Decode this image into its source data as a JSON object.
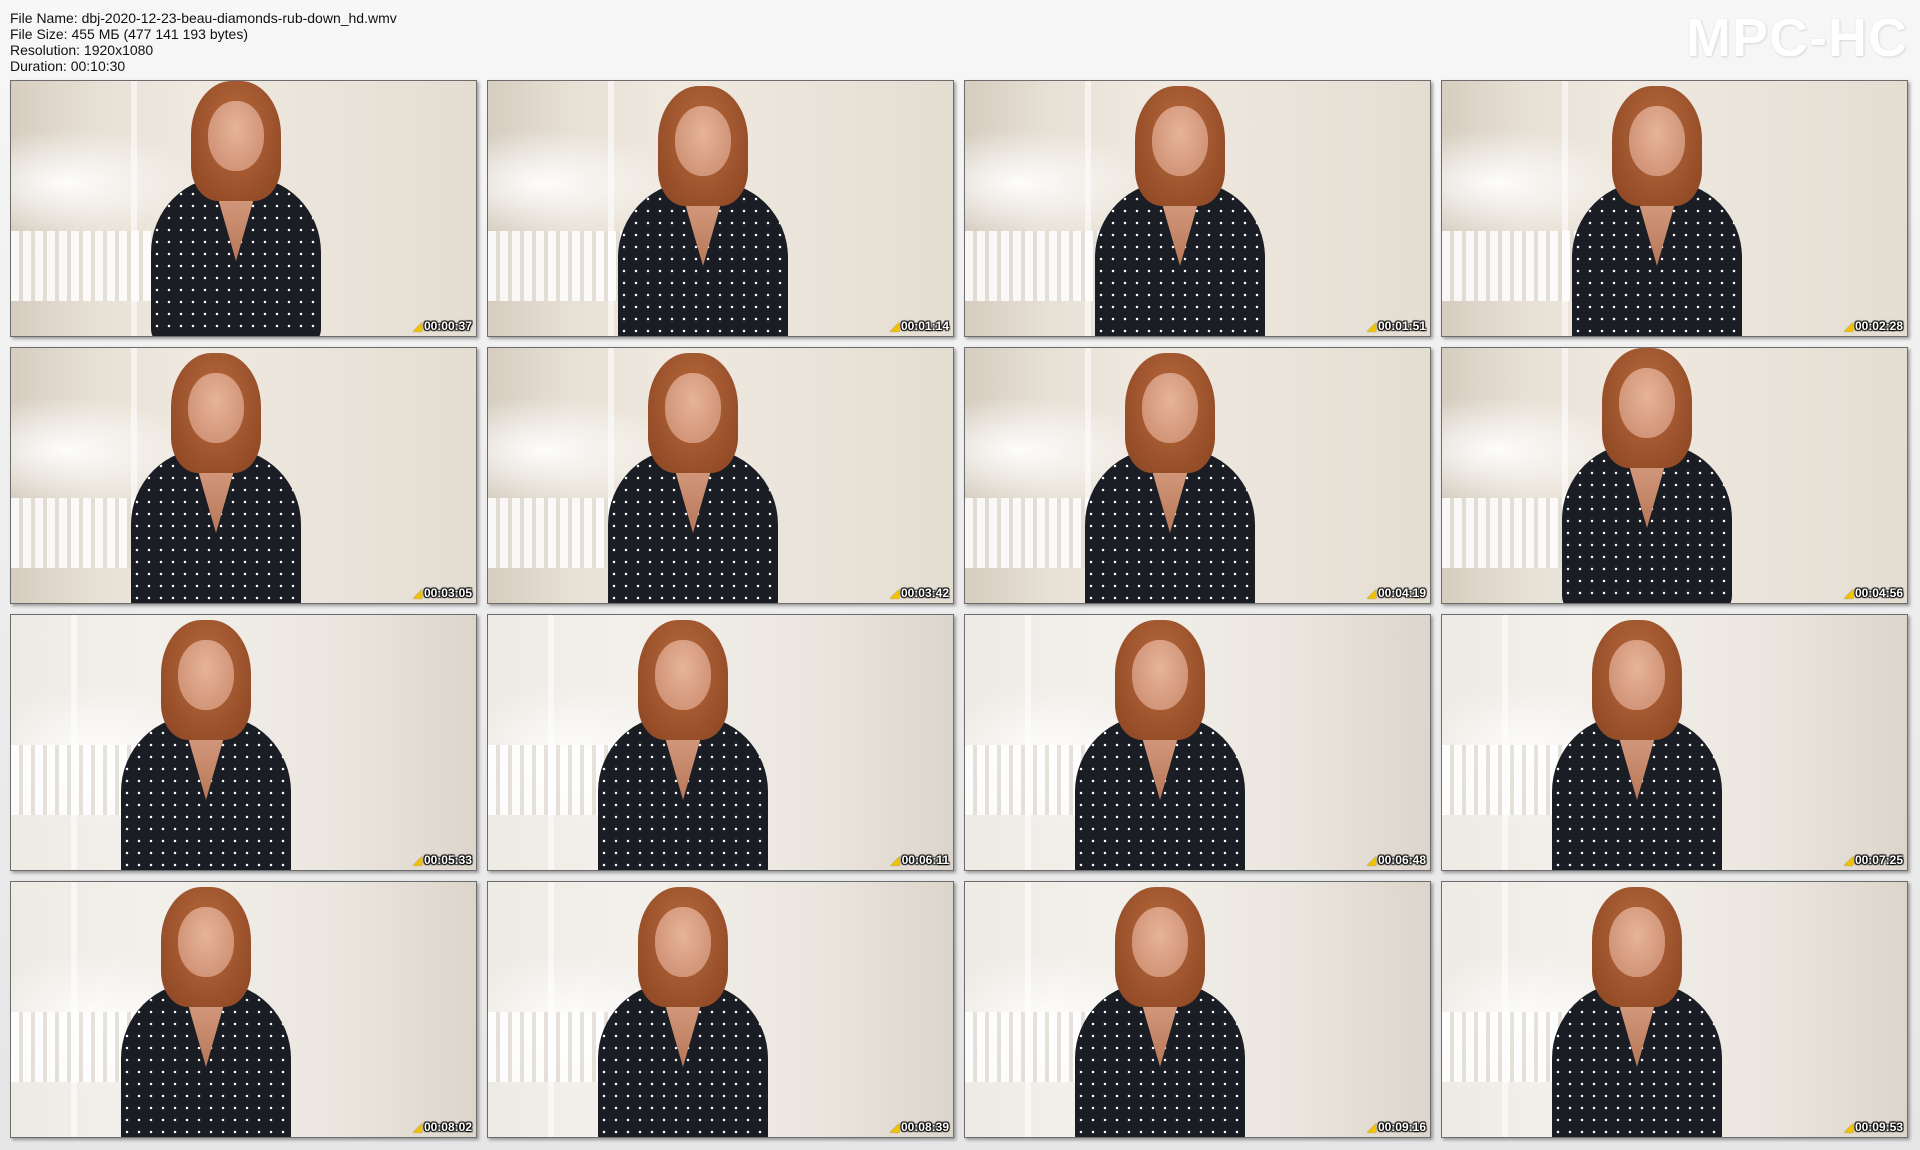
{
  "info": {
    "file_name": "File Name: dbj-2020-12-23-beau-diamonds-rub-down_hd.wmv",
    "file_size": "File Size: 455 МБ (477 141 193 bytes)",
    "resolution": "Resolution: 1920x1080",
    "duration": "Duration: 00:10:30"
  },
  "brand": "MPC-HC",
  "thumbnails": [
    {
      "time": "00:00:37",
      "scene": "A"
    },
    {
      "time": "00:01:14",
      "scene": "A"
    },
    {
      "time": "00:01:51",
      "scene": "A"
    },
    {
      "time": "00:02:28",
      "scene": "A"
    },
    {
      "time": "00:03:05",
      "scene": "A"
    },
    {
      "time": "00:03:42",
      "scene": "A"
    },
    {
      "time": "00:04:19",
      "scene": "A"
    },
    {
      "time": "00:04:56",
      "scene": "A"
    },
    {
      "time": "00:05:33",
      "scene": "B"
    },
    {
      "time": "00:06:11",
      "scene": "B"
    },
    {
      "time": "00:06:48",
      "scene": "B"
    },
    {
      "time": "00:07:25",
      "scene": "B"
    },
    {
      "time": "00:08:02",
      "scene": "B"
    },
    {
      "time": "00:08:39",
      "scene": "B"
    },
    {
      "time": "00:09:16",
      "scene": "B"
    },
    {
      "time": "00:09:53",
      "scene": "B"
    }
  ],
  "timestamp_icon": "timestamp-icon"
}
